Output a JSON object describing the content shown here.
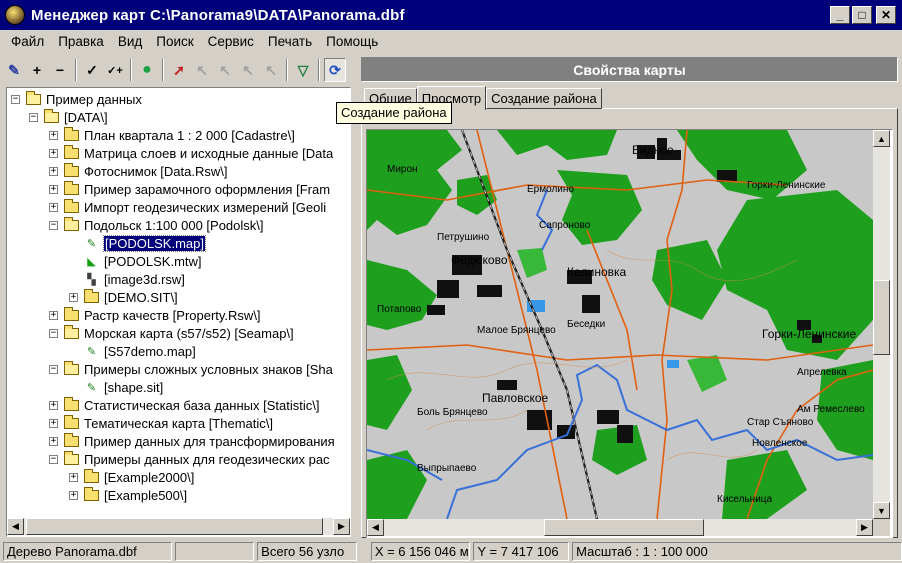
{
  "window": {
    "title": "Менеджер карт C:\\Panorama9\\DATA\\Panorama.dbf",
    "minimize_glyph": "_",
    "maximize_glyph": "□",
    "close_glyph": "✕"
  },
  "menu": [
    "Файл",
    "Правка",
    "Вид",
    "Поиск",
    "Сервис",
    "Печать",
    "Помощь"
  ],
  "toolbar": {
    "buttons": [
      {
        "name": "edit-list-icon",
        "glyph": "✎"
      },
      {
        "name": "add-icon",
        "glyph": "+"
      },
      {
        "name": "remove-icon",
        "glyph": "−"
      },
      {
        "name": "check-icon",
        "glyph": "✓"
      },
      {
        "name": "check-plus-icon",
        "glyph": "✓+"
      },
      {
        "name": "globe-icon",
        "glyph": "●"
      },
      {
        "name": "select-tool-icon",
        "glyph": "➚"
      },
      {
        "name": "pointer-a-icon",
        "glyph": "↖"
      },
      {
        "name": "pointer-b-icon",
        "glyph": "↖"
      },
      {
        "name": "pointer-c-icon",
        "glyph": "↖"
      },
      {
        "name": "pointer-d-icon",
        "glyph": "↖"
      },
      {
        "name": "filter-icon",
        "glyph": "▽"
      },
      {
        "name": "create-region-icon",
        "glyph": "⟳"
      }
    ],
    "tooltip": "Создание района"
  },
  "tree": {
    "rows": [
      {
        "label": "Пример данных",
        "level": 0,
        "expander": "−",
        "icon": "folder-open"
      },
      {
        "label": "[DATA\\]",
        "level": 1,
        "expander": "−",
        "icon": "folder-open"
      },
      {
        "label": "План квартала 1 : 2 000 [Cadastre\\]",
        "level": 2,
        "expander": "+",
        "icon": "folder"
      },
      {
        "label": "Матрица слоев и исходные данные [Data",
        "level": 2,
        "expander": "+",
        "icon": "folder"
      },
      {
        "label": "Фотоснимок [Data.Rsw\\]",
        "level": 2,
        "expander": "+",
        "icon": "folder"
      },
      {
        "label": "Пример зарамочного оформления [Fram",
        "level": 2,
        "expander": "+",
        "icon": "folder"
      },
      {
        "label": "Импорт геодезических измерений [Geoli",
        "level": 2,
        "expander": "+",
        "icon": "folder"
      },
      {
        "label": "Подольск 1:100 000 [Podolsk\\]",
        "level": 2,
        "expander": "−",
        "icon": "folder-open"
      },
      {
        "label": "[PODOLSK.map]",
        "level": 3,
        "expander": "",
        "icon": "map-file",
        "selected": true
      },
      {
        "label": "[PODOLSK.mtw]",
        "level": 3,
        "expander": "",
        "icon": "matrix-file"
      },
      {
        "label": "[image3d.rsw]",
        "level": 3,
        "expander": "",
        "icon": "raster-file"
      },
      {
        "label": "[DEMO.SIT\\]",
        "level": 3,
        "expander": "+",
        "icon": "folder"
      },
      {
        "label": "Растр качеств [Property.Rsw\\]",
        "level": 2,
        "expander": "+",
        "icon": "folder"
      },
      {
        "label": "Морская карта (s57/s52) [Seamap\\]",
        "level": 2,
        "expander": "−",
        "icon": "folder-open"
      },
      {
        "label": "[S57demo.map]",
        "level": 3,
        "expander": "",
        "icon": "map-file"
      },
      {
        "label": "Примеры сложных условных знаков [Sha",
        "level": 2,
        "expander": "−",
        "icon": "folder-open"
      },
      {
        "label": "[shape.sit]",
        "level": 3,
        "expander": "",
        "icon": "map-file"
      },
      {
        "label": "Статистическая  база данных [Statistic\\]",
        "level": 2,
        "expander": "+",
        "icon": "folder"
      },
      {
        "label": "Тематическая карта [Thematic\\]",
        "level": 2,
        "expander": "+",
        "icon": "folder"
      },
      {
        "label": "Пример данных для трансформирования",
        "level": 2,
        "expander": "+",
        "icon": "folder"
      },
      {
        "label": "Примеры данных для геодезических рас",
        "level": 2,
        "expander": "−",
        "icon": "folder-open"
      },
      {
        "label": "[Example2000\\]",
        "level": 3,
        "expander": "+",
        "icon": "folder"
      },
      {
        "label": "[Example500\\]",
        "level": 3,
        "expander": "+",
        "icon": "folder"
      }
    ]
  },
  "status": {
    "tree_name": "Дерево Panorama.dbf",
    "empty": "",
    "total": "Всего 56 узло",
    "x_coord": "X = 6 156 046 м",
    "y_coord": "Y = 7 417 106",
    "scale": "Масштаб :  1 : 100 000"
  },
  "properties": {
    "header": "Свойства карты",
    "tabs": [
      "Общие",
      "Просмотр",
      "Создание района"
    ],
    "active_tab": "Просмотр"
  },
  "map": {
    "labels": [
      "Видное",
      "Ермолино",
      "Сапроново",
      "Федюково",
      "Калиновка",
      "Горки-Ленинские",
      "Горки-Ленинские",
      "Малое Брянцево",
      "Павловское",
      "Боль Брянцево",
      "Выпрыпаево",
      "Новленское",
      "Кисельница",
      "Стар Съяново",
      "Петрушино",
      "Потапово",
      "Беседки",
      "Ам Ремеслево",
      "Апрелевка",
      "Мирон"
    ],
    "colors": {
      "forest": "#1ea01e",
      "forest_light": "#38b838",
      "field": "#c8c8c8",
      "river": "#3870d8",
      "road": "#e06010",
      "urban": "#101010",
      "water_body": "#3898e8"
    }
  }
}
